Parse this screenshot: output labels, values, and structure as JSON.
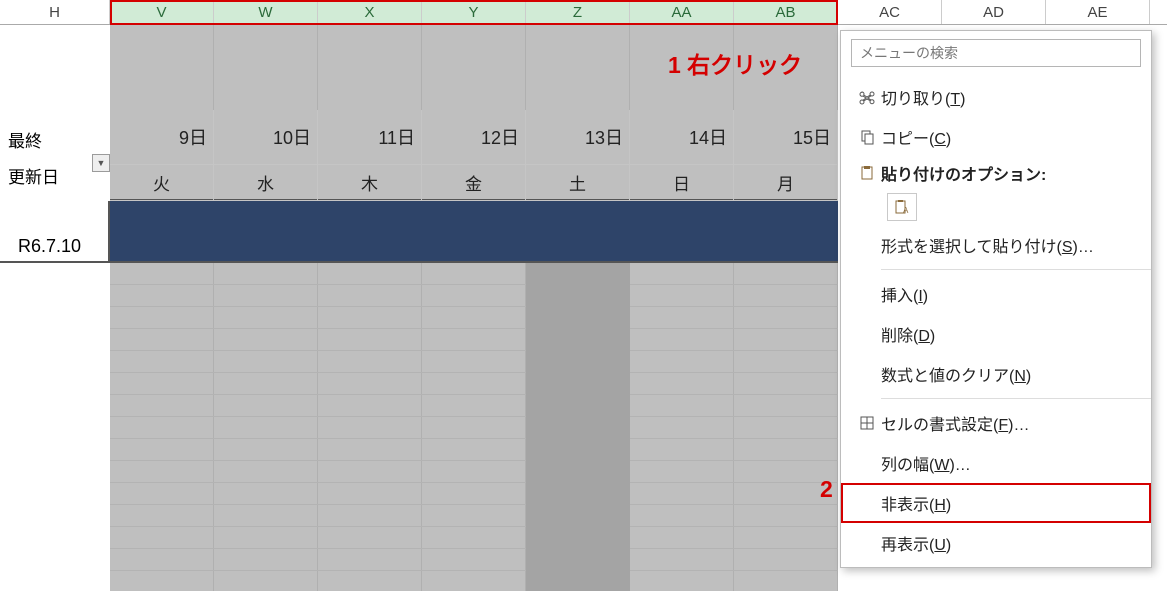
{
  "columns": [
    "H",
    "V",
    "W",
    "X",
    "Y",
    "Z",
    "AA",
    "AB",
    "AC",
    "AD",
    "AE"
  ],
  "selected_columns": [
    "V",
    "W",
    "X",
    "Y",
    "Z",
    "AA",
    "AB"
  ],
  "row_labels": {
    "line1": "最終",
    "line2": "更新日"
  },
  "cell_r67": "R6.7.10",
  "dates": [
    "9日",
    "10日",
    "11日",
    "12日",
    "13日",
    "14日",
    "15日"
  ],
  "weekdays": [
    "火",
    "水",
    "木",
    "金",
    "土",
    "日",
    "月"
  ],
  "annotations": {
    "one": "1 右クリック",
    "two": "2"
  },
  "context_menu": {
    "search_placeholder": "メニューの検索",
    "cut": "切り取り(T)",
    "copy": "コピー(C)",
    "paste_options_label": "貼り付けのオプション:",
    "paste_special": "形式を選択して貼り付け(S)…",
    "insert": "挿入(I)",
    "delete": "削除(D)",
    "clear": "数式と値のクリア(N)",
    "format_cells": "セルの書式設定(F)…",
    "col_width": "列の幅(W)…",
    "hide": "非表示(H)",
    "unhide": "再表示(U)"
  }
}
